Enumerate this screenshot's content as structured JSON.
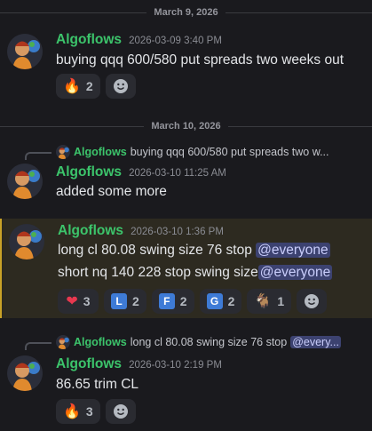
{
  "dividers": [
    "March 9, 2026",
    "March 10, 2026"
  ],
  "messages": [
    {
      "author": "Algoflows",
      "timestamp": "2026-03-09 3:40 PM",
      "lines": [
        "buying qqq 600/580 put spreads two weeks out"
      ],
      "reactions": [
        {
          "icon": "fire-emoji",
          "glyph": "🔥",
          "count": "2"
        }
      ]
    },
    {
      "reply": {
        "author": "Algoflows",
        "text": "buying qqq 600/580 put spreads two w..."
      },
      "author": "Algoflows",
      "timestamp": "2026-03-10 11:25 AM",
      "lines": [
        "added some more"
      ]
    },
    {
      "author": "Algoflows",
      "timestamp": "2026-03-10 1:36 PM",
      "lines": [
        {
          "text": "long cl 80.08 swing size 76 stop ",
          "mention": "@everyone"
        },
        {
          "text": "short nq 140 228 stop  swing size",
          "mention": "@everyone"
        }
      ],
      "reactions": [
        {
          "icon": "heart-emoji",
          "glyph": "❤",
          "count": "3"
        },
        {
          "icon": "regional-l-emoji",
          "glyph": "L",
          "count": "2"
        },
        {
          "icon": "regional-f-emoji",
          "glyph": "F",
          "count": "2"
        },
        {
          "icon": "regional-g-emoji",
          "glyph": "G",
          "count": "2"
        },
        {
          "icon": "goat-emoji",
          "glyph": "🐐",
          "count": "1"
        }
      ]
    },
    {
      "reply": {
        "author": "Algoflows",
        "text": "long cl 80.08 swing size 76 stop ",
        "mention": "@every..."
      },
      "author": "Algoflows",
      "timestamp": "2026-03-10 2:19 PM",
      "lines": [
        "86.65 trim CL"
      ],
      "reactions": [
        {
          "icon": "fire-emoji",
          "glyph": "🔥",
          "count": "3"
        }
      ]
    }
  ],
  "colors": {
    "background": "#1a1a1e",
    "author": "#3cc46b",
    "highlight": "#2d2a20",
    "mention_bg": "#3c4270"
  }
}
